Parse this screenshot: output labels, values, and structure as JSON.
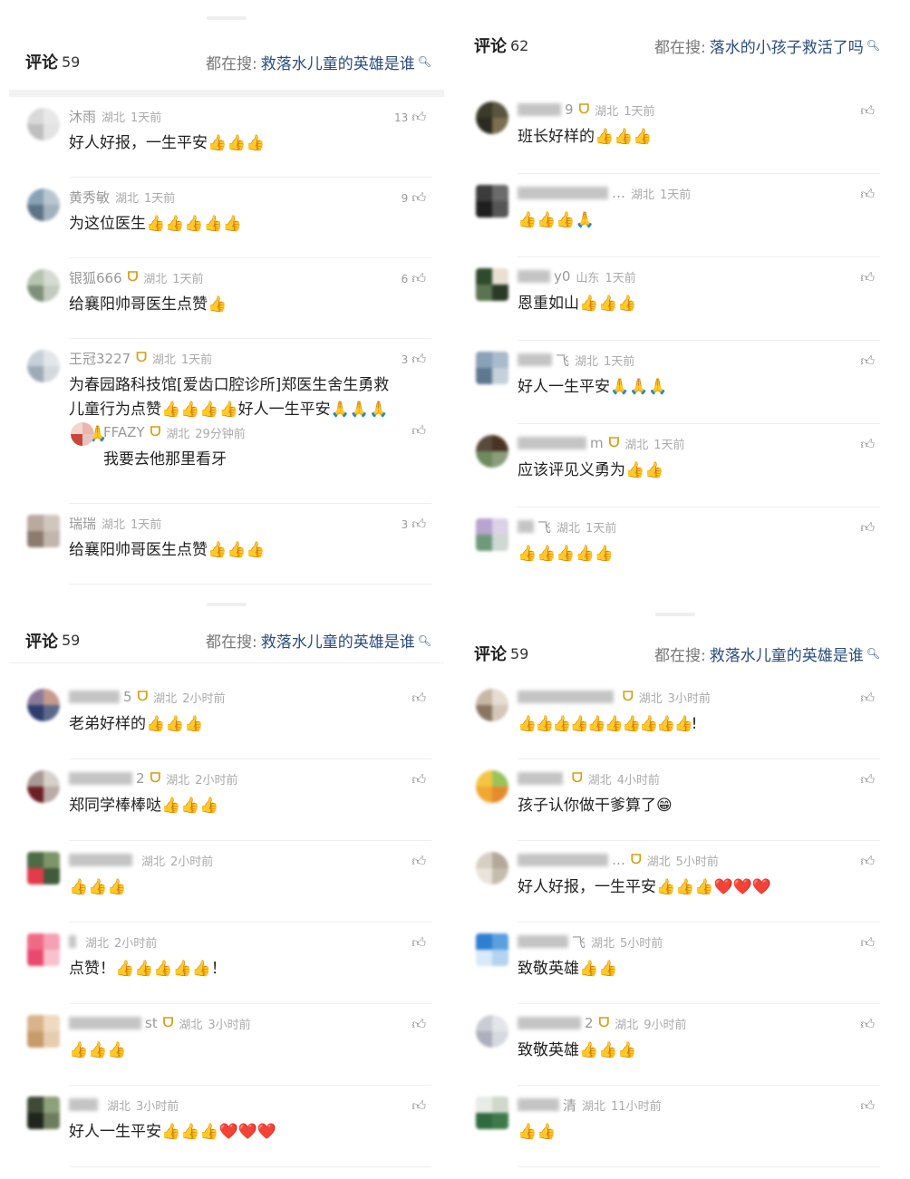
{
  "panels": [
    {
      "title": "评论",
      "count": "59",
      "search_prefix": "都在搜:",
      "search_query": "救落水儿童的英雄是谁",
      "comments": [
        {
          "name": "沐雨",
          "badge": "",
          "location": "湖北",
          "time": "1天前",
          "likes": "13",
          "text": "好人好报，一生平安👍👍👍"
        },
        {
          "name": "黄秀敏",
          "badge": "",
          "location": "湖北",
          "time": "1天前",
          "likes": "9",
          "text": "为这位医生👍👍👍👍👍"
        },
        {
          "name": "银狐666",
          "badge": "ᗜ",
          "location": "湖北",
          "time": "1天前",
          "likes": "6",
          "text": "给襄阳帅哥医生点赞👍"
        },
        {
          "name": "王冠3227",
          "badge": "ᗜ",
          "location": "湖北",
          "time": "1天前",
          "likes": "3",
          "text": "为春园路科技馆[爱齿口腔诊所]郑医生舍生勇救儿童行为点赞👍👍👍👍好人一生平安🙏🙏🙏🙏🙏",
          "reply": {
            "name": "FFAZY",
            "badge": "ᗜ",
            "location": "湖北",
            "time": "29分钟前",
            "text": "我要去他那里看牙"
          }
        },
        {
          "name": "瑞瑞",
          "badge": "",
          "location": "湖北",
          "time": "1天前",
          "likes": "3",
          "text": "给襄阳帅哥医生点赞👍👍👍"
        }
      ]
    },
    {
      "title": "评论",
      "count": "62",
      "search_prefix": "都在搜:",
      "search_query": "落水的小孩子救活了吗",
      "comments": [
        {
          "name": "9",
          "badge": "ᗜ",
          "location": "湖北",
          "time": "1天前",
          "likes": "",
          "text": "班长好样的👍👍👍"
        },
        {
          "name": "…",
          "badge": "",
          "location": "湖北",
          "time": "1天前",
          "likes": "",
          "text": "👍👍👍🙏"
        },
        {
          "name": "y0",
          "badge": "",
          "location": "山东",
          "time": "1天前",
          "likes": "",
          "text": "恩重如山👍👍👍"
        },
        {
          "name": "飞",
          "badge": "",
          "location": "湖北",
          "time": "1天前",
          "likes": "",
          "text": "好人一生平安🙏🙏🙏"
        },
        {
          "name": "m",
          "badge": "ᗜ",
          "location": "湖北",
          "time": "1天前",
          "likes": "",
          "text": "应该评见义勇为👍👍"
        },
        {
          "name": "飞",
          "badge": "",
          "location": "湖北",
          "time": "1天前",
          "likes": "",
          "text": "👍👍👍👍👍"
        }
      ]
    },
    {
      "title": "评论",
      "count": "59",
      "search_prefix": "都在搜:",
      "search_query": "救落水儿童的英雄是谁",
      "comments": [
        {
          "name": "5",
          "badge": "ᗜ",
          "location": "湖北",
          "time": "2小时前",
          "likes": "",
          "text": "老弟好样的👍👍👍"
        },
        {
          "name": "2",
          "badge": "ᗜ",
          "location": "湖北",
          "time": "2小时前",
          "likes": "",
          "text": "郑同学棒棒哒👍👍👍"
        },
        {
          "name": "",
          "badge": "",
          "location": "湖北",
          "time": "2小时前",
          "likes": "",
          "text": "👍👍👍"
        },
        {
          "name": "",
          "badge": "",
          "location": "湖北",
          "time": "2小时前",
          "likes": "",
          "text": "点赞！👍👍👍👍👍！"
        },
        {
          "name": "st",
          "badge": "ᗜ",
          "location": "湖北",
          "time": "3小时前",
          "likes": "",
          "text": "👍👍👍"
        },
        {
          "name": "",
          "badge": "",
          "location": "湖北",
          "time": "3小时前",
          "likes": "",
          "text": "好人一生平安👍👍👍❤️❤️❤️"
        }
      ]
    },
    {
      "title": "评论",
      "count": "59",
      "search_prefix": "都在搜:",
      "search_query": "救落水儿童的英雄是谁",
      "comments": [
        {
          "name": "",
          "badge": "ᗜ",
          "location": "湖北",
          "time": "3小时前",
          "likes": "",
          "text": "👍👍👍👍👍👍👍👍👍👍!"
        },
        {
          "name": "",
          "badge": "ᗜ",
          "location": "湖北",
          "time": "4小时前",
          "likes": "",
          "text": "孩子认你做干爹算了😁"
        },
        {
          "name": "…",
          "badge": "ᗜ",
          "location": "湖北",
          "time": "5小时前",
          "likes": "",
          "text": "好人好报，一生平安👍👍👍❤️❤️❤️"
        },
        {
          "name": "飞",
          "badge": "",
          "location": "湖北",
          "time": "5小时前",
          "likes": "",
          "text": "致敬英雄👍👍"
        },
        {
          "name": "2",
          "badge": "ᗜ",
          "location": "湖北",
          "time": "9小时前",
          "likes": "",
          "text": "致敬英雄👍👍👍"
        },
        {
          "name": "清",
          "badge": "",
          "location": "湖北",
          "time": "11小时前",
          "likes": "",
          "text": "👍👍"
        }
      ]
    }
  ],
  "icons": {
    "like": "thumbs-up-icon",
    "search": "search-icon",
    "badge": "vip-badge-icon"
  },
  "colors": {
    "link": "#2a4c7e",
    "badge": "#d4a017",
    "meta": "#aaaaaa"
  }
}
